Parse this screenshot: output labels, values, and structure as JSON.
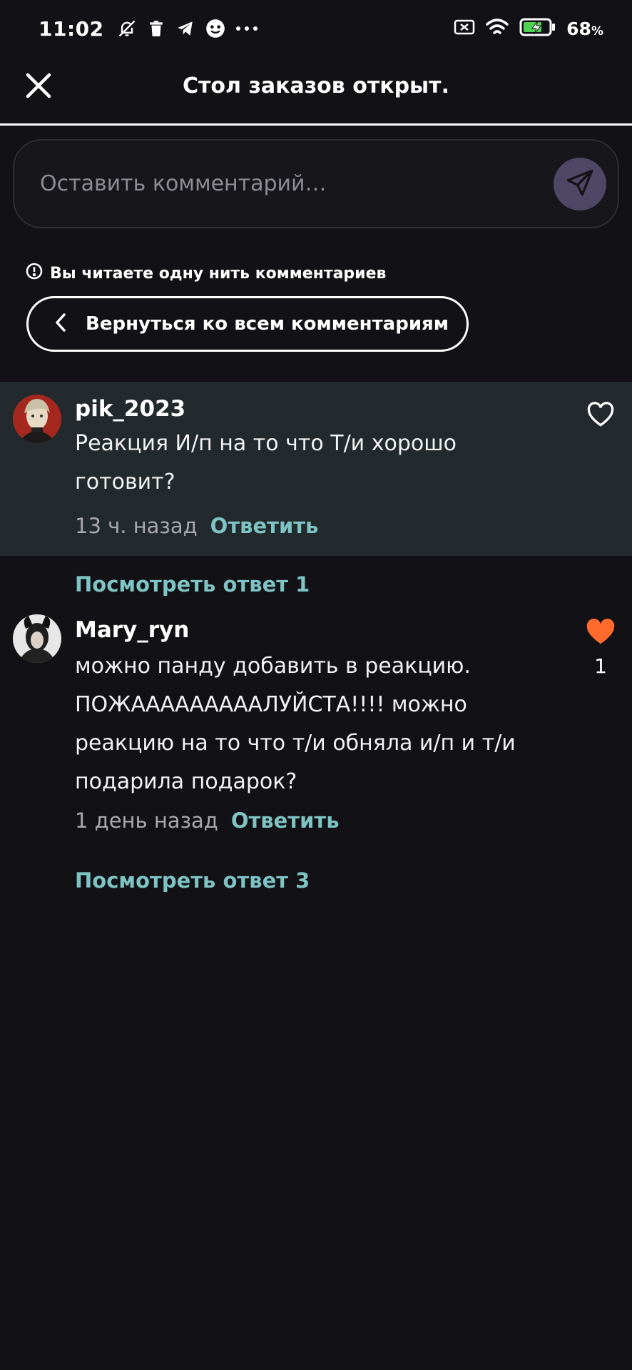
{
  "status_bar": {
    "time": "11:02",
    "battery_percent": "68",
    "battery_unit": "%",
    "icons": [
      "bell-off-icon",
      "trash-icon",
      "telegram-icon",
      "app-icon",
      "more-dots-icon",
      "sim-off-icon",
      "wifi-icon",
      "battery-charging-icon"
    ]
  },
  "header": {
    "title": "Стол заказов открыт.",
    "close_icon": "close-icon"
  },
  "comment_input": {
    "placeholder": "Оставить комментарий…",
    "send_icon": "send-icon",
    "send_color": "#4e4866"
  },
  "thread": {
    "note": "Вы читаете одну нить комментариев",
    "back_label": "Вернуться ко всем комментариям"
  },
  "comments": [
    {
      "username": "pik_2023",
      "text": "Реакция И/п на то что Т/и хорошо готовит?",
      "time": "13 ч. назад",
      "reply_label": "Ответить",
      "liked": false,
      "likes": "",
      "view_replies": "Посмотреть ответ 1"
    },
    {
      "username": "Mary_ryn",
      "text": "можно панду добавить в реакцию. ПОЖАААААААААЛУЙСТА!!!! можно реакцию на то что т/и обняла и/п и т/и подарила подарок?",
      "time": "1 день назад",
      "reply_label": "Ответить",
      "liked": true,
      "likes": "1",
      "view_replies": "Посмотреть ответ 3"
    }
  ],
  "colors": {
    "background": "#121115",
    "highlight": "#222a2d",
    "accent": "#7ec4c4",
    "heart": "#ff6b2c"
  }
}
